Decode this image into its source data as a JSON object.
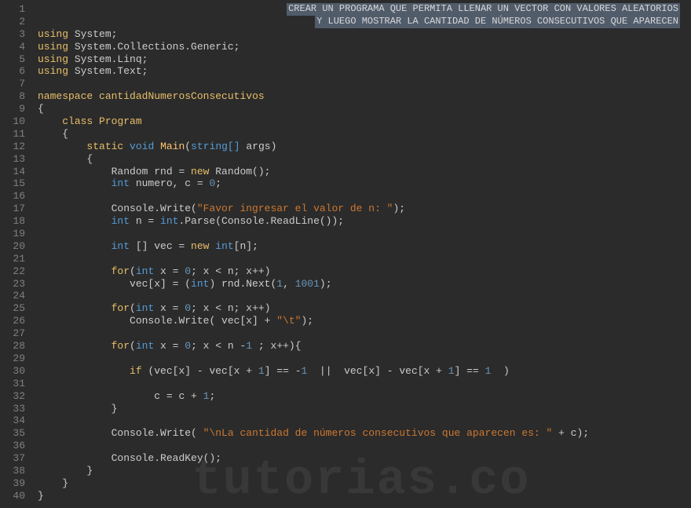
{
  "watermark": "tutorias.co",
  "banner": {
    "line1": "CREAR UN PROGRAMA QUE PERMITA LLENAR UN VECTOR CON VALORES ALEATORIOS",
    "line2": "Y LUEGO MOSTRAR LA CANTIDAD DE NÚMEROS CONSECUTIVOS QUE APARECEN"
  },
  "lineCount": 40,
  "code": {
    "l3": {
      "kw": "using",
      "ns": "System"
    },
    "l4": {
      "kw": "using",
      "ns": "System.Collections.Generic"
    },
    "l5": {
      "kw": "using",
      "ns": "System.Linq"
    },
    "l6": {
      "kw": "using",
      "ns": "System.Text"
    },
    "l8": {
      "kw": "namespace",
      "name": "cantidadNumerosConsecutivos"
    },
    "l9": "{",
    "l10": {
      "kw": "class",
      "name": "Program"
    },
    "l11": "{",
    "l12": {
      "static": "static",
      "void": "void",
      "main": "Main",
      "args": "string[]",
      "argsName": "args"
    },
    "l13": "{",
    "l14": {
      "text1": "Random rnd = ",
      "new": "new",
      "text2": " Random();"
    },
    "l15": {
      "int": "int",
      "text": " numero, c = ",
      "num": "0",
      "semi": ";"
    },
    "l17": {
      "call": "Console.Write(",
      "str": "\"Favor ingresar el valor de n: \"",
      "end": ");"
    },
    "l18": {
      "int": "int",
      "text1": " n = ",
      "int2": "int",
      "text2": ".Parse(Console.ReadLine());"
    },
    "l20": {
      "int": "int",
      "text1": " [] vec = ",
      "new": "new",
      "sp": " ",
      "int2": "int",
      "text2": "[n];"
    },
    "l22": {
      "for": "for",
      "open": "(",
      "int": "int",
      "text1": " x = ",
      "num1": "0",
      "text2": "; x < n; x++)"
    },
    "l23": {
      "text1": "   vec[x] = (",
      "int": "int",
      "text2": ") rnd.Next(",
      "num1": "1",
      "comma": ", ",
      "num2": "1001",
      "end": ");"
    },
    "l25": {
      "for": "for",
      "open": "(",
      "int": "int",
      "text1": " x = ",
      "num1": "0",
      "text2": "; x < n; x++)"
    },
    "l26": {
      "text1": "   Console.Write( vec[x] + ",
      "str": "\"\\t\"",
      "end": ");"
    },
    "l28": {
      "for": "for",
      "open": "(",
      "int": "int",
      "text1": " x = ",
      "num1": "0",
      "text2": "; x < n -",
      "num2": "1",
      "text3": " ; x++){"
    },
    "l30": {
      "if": "if",
      "text1": " (vec[x] - vec[x + ",
      "num1": "1",
      "text2": "] == -",
      "num2": "1",
      "or": "  ||  ",
      "text3": "vec[x] - vec[x + ",
      "num3": "1",
      "text4": "] == ",
      "num4": "1",
      "end": "  )"
    },
    "l32": {
      "text1": "c = c + ",
      "num": "1",
      "semi": ";"
    },
    "l33": "}",
    "l35": {
      "text1": "Console.Write( ",
      "str": "\"\\nLa cantidad de números consecutivos que aparecen es: \"",
      "text2": " + c);"
    },
    "l37": "Console.ReadKey();",
    "l38": "}",
    "l39": "}",
    "l40": "}"
  }
}
